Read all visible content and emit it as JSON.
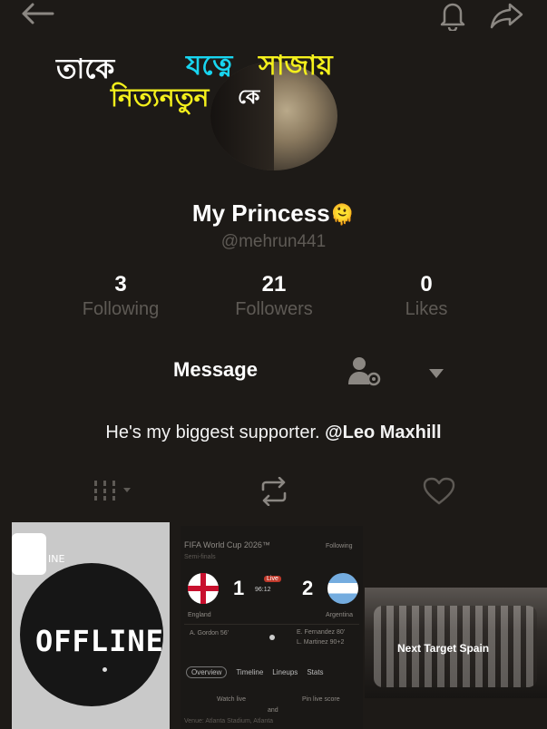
{
  "overlay_text": {
    "line1_a": "তাকে",
    "line1_b": "যত্নে",
    "line1_c": "সাজায়",
    "line2_a": "নিত্যনতুন",
    "line2_b": "কে"
  },
  "profile": {
    "name": "My Princess",
    "name_emoji": "🫠",
    "handle": "@mehrun441"
  },
  "stats": [
    {
      "value": "3",
      "label": "Following"
    },
    {
      "value": "21",
      "label": "Followers"
    },
    {
      "value": "0",
      "label": "Likes"
    }
  ],
  "actions": {
    "message_label": "Message"
  },
  "bio": {
    "text": "He's my biggest supporter.",
    "mention": "@Leo Maxhill"
  },
  "tiles": {
    "offline": {
      "badge_text": "INE",
      "big_text": "OFFLINE"
    },
    "score": {
      "title": "FIFA World Cup 2026™",
      "follow_label": "Following",
      "sub": "Semi-finals",
      "home_score": "1",
      "away_score": "2",
      "live_badge": "Live",
      "minute": "96:12",
      "home_team": "England",
      "away_team": "Argentina",
      "home_scorer": "A. Gordon 56'",
      "away_scorer_1": "E. Fernandez 80'",
      "away_scorer_2": "L. Martinez 90+2",
      "tabs": [
        "Overview",
        "Timeline",
        "Lineups",
        "Stats"
      ],
      "watch_live": "Watch live",
      "pin_score": "Pin live score",
      "venue_short": "and",
      "venue": "Venue: Atlanta Stadium, Atlanta"
    },
    "team": {
      "caption": "Next Target Spain"
    }
  },
  "colors": {
    "background": "#1d1a17",
    "muted": "#5e5a55",
    "yellow": "#f4f01c",
    "cyan": "#18d5f0"
  }
}
